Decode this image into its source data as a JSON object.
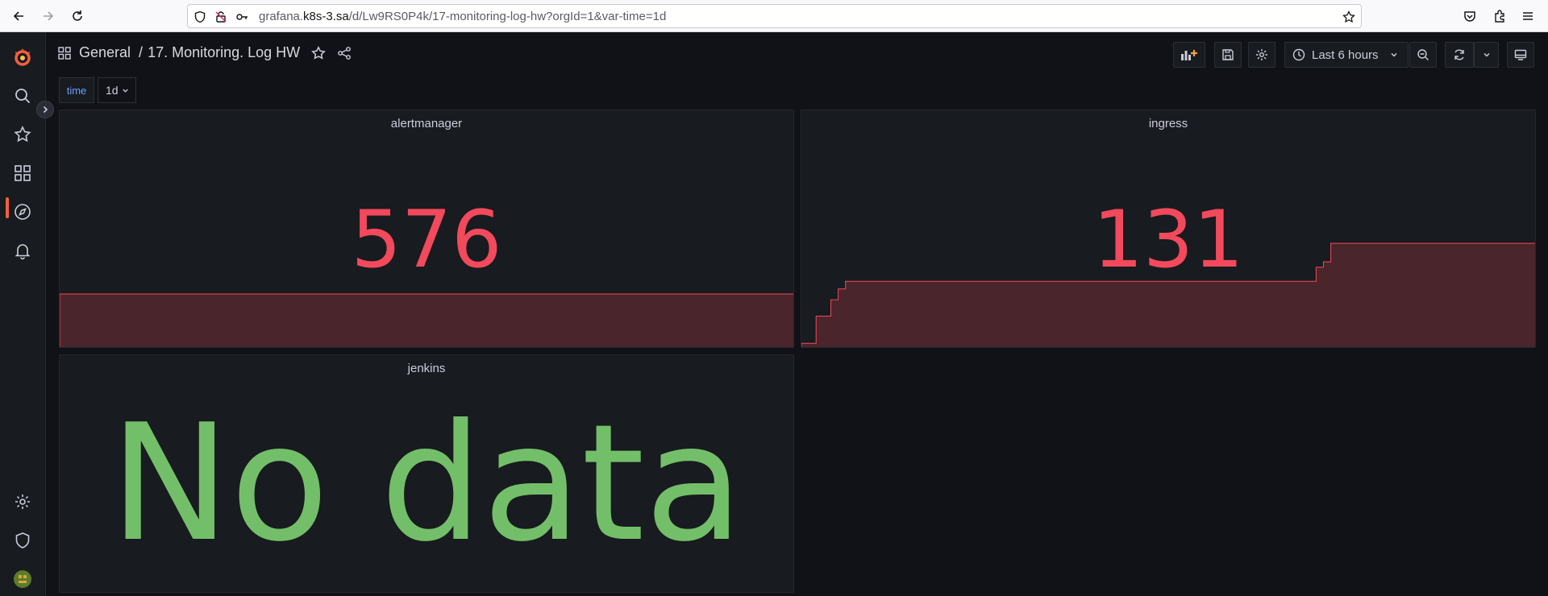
{
  "browser": {
    "url_prefix": "grafana.",
    "url_host": "k8s-3.sa",
    "url_path": "/d/Lw9RS0P4k/17-monitoring-log-hw?orgId=1&var-time=1d"
  },
  "breadcrumb": {
    "folder": "General",
    "separator": "/",
    "dashboard": "17. Monitoring. Log HW"
  },
  "toolbar": {
    "time_range": "Last 6 hours"
  },
  "variables": {
    "time_label": "time",
    "time_value": "1d"
  },
  "panels": {
    "alertmanager": {
      "title": "alertmanager",
      "value": "576",
      "sparkline_level": 0.5
    },
    "ingress": {
      "title": "ingress",
      "value": "131",
      "sparkline": [
        0.05,
        0.05,
        0.3,
        0.3,
        0.45,
        0.55,
        0.62,
        0.62,
        0.62,
        0.62,
        0.62,
        0.62,
        0.62,
        0.62,
        0.62,
        0.62,
        0.62,
        0.62,
        0.62,
        0.62,
        0.62,
        0.62,
        0.62,
        0.62,
        0.62,
        0.62,
        0.62,
        0.62,
        0.62,
        0.62,
        0.62,
        0.62,
        0.62,
        0.62,
        0.62,
        0.62,
        0.62,
        0.62,
        0.62,
        0.62,
        0.62,
        0.62,
        0.62,
        0.62,
        0.62,
        0.62,
        0.62,
        0.62,
        0.62,
        0.62,
        0.62,
        0.62,
        0.62,
        0.62,
        0.62,
        0.62,
        0.62,
        0.62,
        0.62,
        0.62,
        0.62,
        0.62,
        0.62,
        0.62,
        0.62,
        0.62,
        0.62,
        0.62,
        0.62,
        0.62,
        0.75,
        0.8,
        0.97,
        0.97,
        0.97,
        0.97,
        0.97,
        0.97,
        0.97,
        0.97,
        0.97,
        0.97,
        0.97,
        0.97,
        0.97,
        0.97,
        0.97,
        0.97,
        0.97,
        0.97,
        0.97,
        0.97,
        0.97,
        0.97,
        0.97,
        0.97,
        0.97,
        0.97,
        0.97,
        0.97
      ]
    },
    "jenkins": {
      "title": "jenkins",
      "value": "No data"
    }
  },
  "colors": {
    "stat_red": "#f2495c",
    "no_data_green": "#73bf69",
    "brand_orange": "#f55f3e"
  }
}
